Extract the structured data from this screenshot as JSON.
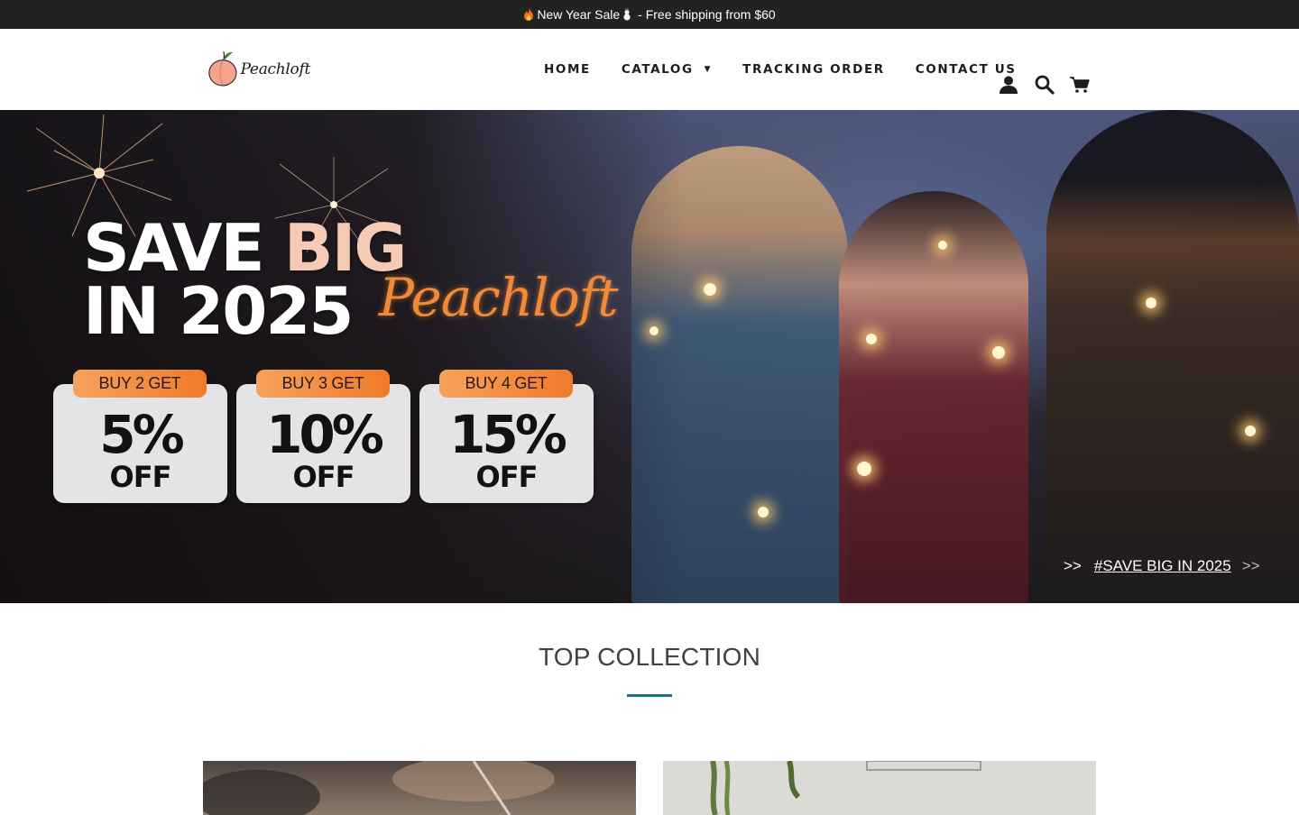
{
  "announcement": {
    "text_before": "New Year Sale",
    "text_after": " - Free shipping from $60",
    "icons": [
      "flame-icon",
      "snowman-icon"
    ]
  },
  "header": {
    "logo_text": "Peachloft",
    "nav": [
      {
        "label": "HOME"
      },
      {
        "label": "CATALOG",
        "has_dropdown": true
      },
      {
        "label": "TRACKING ORDER"
      },
      {
        "label": "CONTACT US"
      }
    ],
    "icons": [
      "account-icon",
      "search-icon",
      "cart-icon"
    ]
  },
  "hero": {
    "headline_line1_a": "SAVE",
    "headline_line1_b": "BIG",
    "headline_line2": "IN 2025",
    "script_text": "Peachloft",
    "deals": [
      {
        "tag": "BUY 2 GET",
        "percent": "5%",
        "off": "OFF"
      },
      {
        "tag": "BUY 3 GET",
        "percent": "10%",
        "off": "OFF"
      },
      {
        "tag": "BUY 4 GET",
        "percent": "15%",
        "off": "OFF"
      }
    ],
    "link_prefix": ">>",
    "link_text": "#SAVE BIG IN 2025",
    "link_suffix": ">>"
  },
  "collection": {
    "title": "TOP COLLECTION"
  },
  "colors": {
    "announcement_bg": "#222222",
    "accent_rule": "#1f6f86",
    "deal_tag": "#f07a2a"
  }
}
